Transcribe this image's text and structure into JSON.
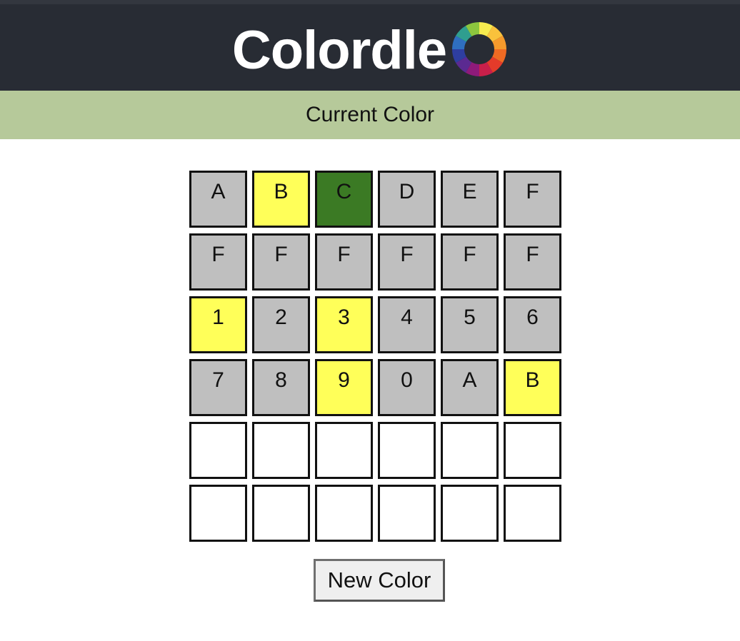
{
  "header": {
    "title": "Colordle",
    "logo_icon": "color-wheel-icon"
  },
  "banner": {
    "label": "Current Color"
  },
  "colors": {
    "header_bg": "#282c34",
    "banner_bg": "#b6c99a",
    "tile_gray": "#bfbfbf",
    "tile_yellow": "#ffff59",
    "tile_green": "#3b7a24",
    "tile_empty": "#ffffff"
  },
  "grid": {
    "rows": [
      [
        {
          "letter": "A",
          "state": "gray"
        },
        {
          "letter": "B",
          "state": "yellow"
        },
        {
          "letter": "C",
          "state": "green"
        },
        {
          "letter": "D",
          "state": "gray"
        },
        {
          "letter": "E",
          "state": "gray"
        },
        {
          "letter": "F",
          "state": "gray"
        }
      ],
      [
        {
          "letter": "F",
          "state": "gray"
        },
        {
          "letter": "F",
          "state": "gray"
        },
        {
          "letter": "F",
          "state": "gray"
        },
        {
          "letter": "F",
          "state": "gray"
        },
        {
          "letter": "F",
          "state": "gray"
        },
        {
          "letter": "F",
          "state": "gray"
        }
      ],
      [
        {
          "letter": "1",
          "state": "yellow"
        },
        {
          "letter": "2",
          "state": "gray"
        },
        {
          "letter": "3",
          "state": "yellow"
        },
        {
          "letter": "4",
          "state": "gray"
        },
        {
          "letter": "5",
          "state": "gray"
        },
        {
          "letter": "6",
          "state": "gray"
        }
      ],
      [
        {
          "letter": "7",
          "state": "gray"
        },
        {
          "letter": "8",
          "state": "gray"
        },
        {
          "letter": "9",
          "state": "yellow"
        },
        {
          "letter": "0",
          "state": "gray"
        },
        {
          "letter": "A",
          "state": "gray"
        },
        {
          "letter": "B",
          "state": "yellow"
        }
      ],
      [
        {
          "letter": "",
          "state": "empty"
        },
        {
          "letter": "",
          "state": "empty"
        },
        {
          "letter": "",
          "state": "empty"
        },
        {
          "letter": "",
          "state": "empty"
        },
        {
          "letter": "",
          "state": "empty"
        },
        {
          "letter": "",
          "state": "empty"
        }
      ],
      [
        {
          "letter": "",
          "state": "empty"
        },
        {
          "letter": "",
          "state": "empty"
        },
        {
          "letter": "",
          "state": "empty"
        },
        {
          "letter": "",
          "state": "empty"
        },
        {
          "letter": "",
          "state": "empty"
        },
        {
          "letter": "",
          "state": "empty"
        }
      ]
    ]
  },
  "controls": {
    "new_color_label": "New Color"
  }
}
